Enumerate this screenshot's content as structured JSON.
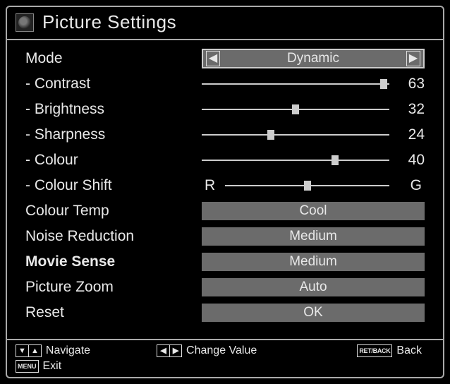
{
  "header": {
    "title": "Picture Settings"
  },
  "rows": {
    "mode": {
      "label": "Mode",
      "value": "Dynamic"
    },
    "contrast": {
      "label": "- Contrast",
      "value": 63,
      "pct": 97
    },
    "brightness": {
      "label": "- Brightness",
      "value": 32,
      "pct": 50
    },
    "sharpness": {
      "label": "- Sharpness",
      "value": 24,
      "pct": 37
    },
    "colour": {
      "label": "- Colour",
      "value": 40,
      "pct": 71
    },
    "colourShift": {
      "label": "- Colour Shift",
      "left": "R",
      "right": "G",
      "pct": 50
    },
    "colourTemp": {
      "label": "Colour Temp",
      "value": "Cool"
    },
    "noise": {
      "label": "Noise Reduction",
      "value": "Medium"
    },
    "movieSense": {
      "label": "Movie Sense",
      "value": "Medium"
    },
    "zoom": {
      "label": "Picture Zoom",
      "value": "Auto"
    },
    "reset": {
      "label": "Reset",
      "value": "OK"
    }
  },
  "footer": {
    "navigate": "Navigate",
    "change": "Change Value",
    "back": "Back",
    "exit": "Exit",
    "menuKey": "MENU",
    "retKey": "RET/BACK"
  }
}
